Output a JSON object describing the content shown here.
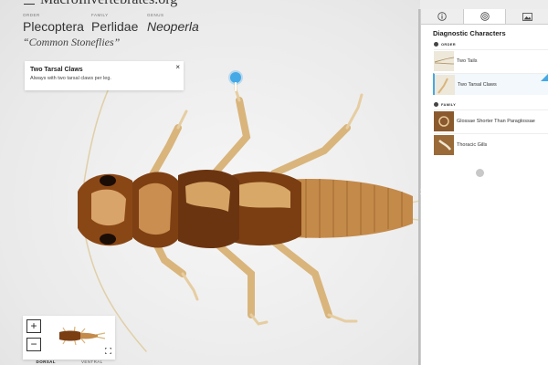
{
  "site": {
    "title": "MacroInvertebrates.org"
  },
  "taxonomy": {
    "order_label": "ORDER",
    "order": "Plecoptera",
    "family_label": "FAMILY",
    "family": "Perlidae",
    "genus_label": "GENUS",
    "genus": "Neoperla",
    "common_name": "“Common Stoneflies”"
  },
  "tooltip": {
    "title": "Two Tarsal Claws",
    "description": "Always with two tarsal claws per leg.",
    "close": "×"
  },
  "zoom": {
    "in_label": "+",
    "out_label": "−"
  },
  "view_tabs": [
    {
      "label": "DORSAL",
      "active": true
    },
    {
      "label": "VENTRAL",
      "active": false
    }
  ],
  "panel": {
    "tabs": [
      {
        "icon": "info-icon",
        "active": false
      },
      {
        "icon": "target-icon",
        "active": true
      },
      {
        "icon": "image-icon",
        "active": false
      }
    ],
    "heading": "Diagnostic Characters",
    "sections": [
      {
        "label": "ORDER",
        "items": [
          {
            "label": "Two Tails",
            "selected": false
          },
          {
            "label": "Two Tarsal Claws",
            "selected": true
          }
        ]
      },
      {
        "label": "FAMILY",
        "items": [
          {
            "label": "Glossae Shorter Than Paraglossae",
            "selected": false
          },
          {
            "label": "Thoracic Gills",
            "selected": false
          }
        ]
      }
    ]
  },
  "colors": {
    "accent": "#45a9e6",
    "body_dark": "#7a3e12",
    "body_light": "#c48a4a",
    "leg": "#d8b277"
  }
}
